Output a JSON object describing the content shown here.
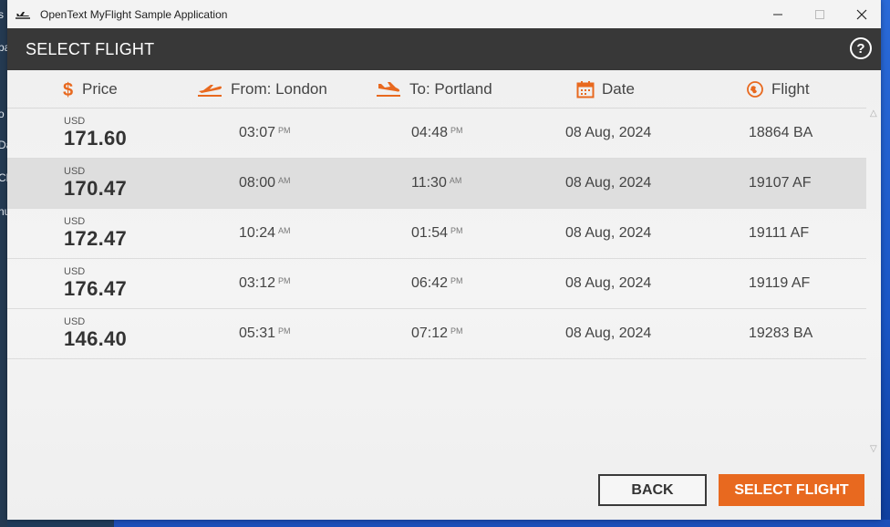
{
  "window": {
    "title": "OpenText MyFlight Sample Application"
  },
  "header": {
    "title": "SELECT FLIGHT",
    "help_label": "?"
  },
  "columns": {
    "price": "Price",
    "from": "From: London",
    "to": "To: Portland",
    "date": "Date",
    "flight": "Flight"
  },
  "flights": [
    {
      "currency": "USD",
      "price": "171.60",
      "dep_time": "03:07",
      "dep_ampm": "PM",
      "arr_time": "04:48",
      "arr_ampm": "PM",
      "date": "08 Aug, 2024",
      "flight": "18864 BA",
      "selected": false
    },
    {
      "currency": "USD",
      "price": "170.47",
      "dep_time": "08:00",
      "dep_ampm": "AM",
      "arr_time": "11:30",
      "arr_ampm": "AM",
      "date": "08 Aug, 2024",
      "flight": "19107 AF",
      "selected": true
    },
    {
      "currency": "USD",
      "price": "172.47",
      "dep_time": "10:24",
      "dep_ampm": "AM",
      "arr_time": "01:54",
      "arr_ampm": "PM",
      "date": "08 Aug, 2024",
      "flight": "19111 AF",
      "selected": false
    },
    {
      "currency": "USD",
      "price": "176.47",
      "dep_time": "03:12",
      "dep_ampm": "PM",
      "arr_time": "06:42",
      "arr_ampm": "PM",
      "date": "08 Aug, 2024",
      "flight": "19119 AF",
      "selected": false
    },
    {
      "currency": "USD",
      "price": "146.40",
      "dep_time": "05:31",
      "dep_ampm": "PM",
      "arr_time": "07:12",
      "arr_ampm": "PM",
      "date": "08 Aug, 2024",
      "flight": "19283 BA",
      "selected": false
    }
  ],
  "buttons": {
    "back": "BACK",
    "select": "SELECT FLIGHT"
  },
  "background_fragments": [
    "s",
    "pa",
    "o",
    "Da",
    "Cl",
    "nu"
  ],
  "colors": {
    "accent": "#e8691f",
    "header_bg": "#383838",
    "selected_row": "#dedede"
  },
  "icons": [
    "airplane-app-icon",
    "minimize-icon",
    "maximize-icon",
    "close-icon",
    "help-icon",
    "dollar-icon",
    "takeoff-icon",
    "landing-icon",
    "calendar-icon",
    "flight-globe-icon"
  ]
}
